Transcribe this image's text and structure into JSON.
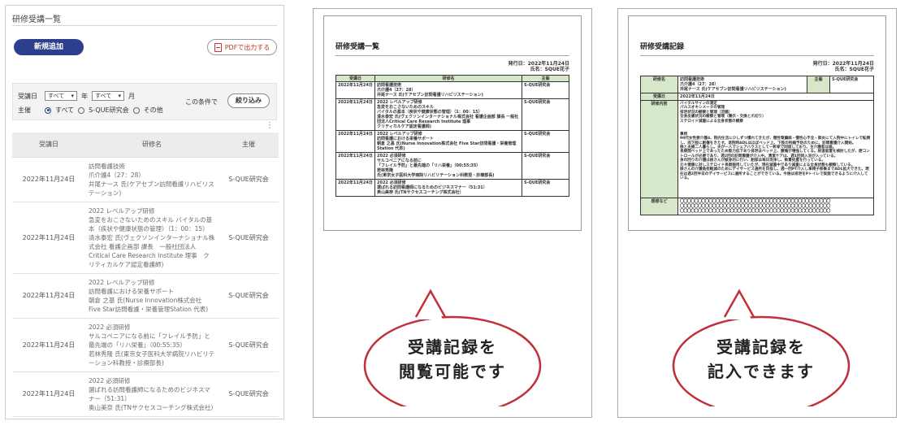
{
  "app": {
    "title": "研修受講一覧",
    "new_button": "新規追加",
    "pdf_button": "PDFで出力する",
    "filter": {
      "received_label": "受講日",
      "year_value": "すべて",
      "year_suffix": "年",
      "month_value": "すべて",
      "month_suffix": "月",
      "host_label": "主催",
      "radio_all": "すべて",
      "radio_sque": "S-QUE研究会",
      "radio_other": "その他",
      "condition_text": "この条件で",
      "narrow_button": "絞り込み"
    },
    "kebab": "⋮",
    "table": {
      "headers": [
        "受講日",
        "研修名",
        "主催"
      ],
      "rows": [
        {
          "date": "2022年11月24日",
          "name": "訪問看護技術\n爪介護4（27：28）\n井尾ナース 氏(ケアセブン訪問看護リハビリステーション)",
          "host": "S-QUE研究会"
        },
        {
          "date": "2022年11月24日",
          "name": "2022 レベルアップ研修\n急変をおこさないためのスキル バイタルの基本（疾状や健康状態の管理）（1：00：15）\n清水泰宏 氏(ヴェクソンインターナショナル株式会社 看護企画部 課長　一般社団法人Critical Care Research Institute 理事　クリティカルケア認定看護師)",
          "host": "S-QUE研究会"
        },
        {
          "date": "2022年11月24日",
          "name": "2022 レベルアップ研修\n訪問看護における栄養サポート\n朝倉 之基 氏(Nurse Innovation株式会社 Five Star訪問看護・栄養管理Station 代表)",
          "host": "S-QUE研究会"
        },
        {
          "date": "2022年11月24日",
          "name": "2022 必須研修\nサルコペニアになる前に「フレイル予防」と最先端の「リハ栄養」（00:55:35）\n若林秀隆 氏(東京女子医科大学病院リハビリテーション科教授・診療部長)",
          "host": "S-QUE研究会"
        },
        {
          "date": "2022年11月24日",
          "name": "2022 必須研修\n選ばれる訪問看護師になるためのビジネスマナー（51:31）\n奥山美奈 氏(TNサクセスコーチング株式会社）",
          "host": "S-QUE研究会"
        }
      ]
    }
  },
  "doc_list": {
    "title": "研修受講一覧",
    "issue_date": "発行日：2022年11月24日",
    "name": "氏名：SQUE花子",
    "headers": [
      "受講日",
      "研修名",
      "主催"
    ],
    "rows": [
      {
        "date": "2022年11月24日",
        "name": "訪問看護技術\n爪介護4（27：28）\n井尾ナース 氏(ケアセブン訪問看護リハビリステーション)",
        "host": "S-QUE研究会"
      },
      {
        "date": "2022年11月24日",
        "name": "2022 レベルアップ研修\n急変をおこさないためのスキル\nバイタルの基本（疾状や健康状態の管理）（1：00：15）\n清水泰宏 氏(ヴェクソンインターナショナル株式会社 看護企画部 課長 一般社団法人Critical Care Research Institute 理事\nクリティカルケア認定看護師)",
        "host": "S-QUE研究会"
      },
      {
        "date": "2022年11月24日",
        "name": "2022 レベルアップ研修\n訪問看護における栄養サポート\n朝倉 之基 氏(Nurse Innovation株式会社 Five Star訪問看護・栄養管理Station 代表)",
        "host": "S-QUE研究会"
      },
      {
        "date": "2022年11月24日",
        "name": "2022 必須研修\nサルコペニアになる前に\n「フレイル予防」と最先端の「リハ栄養」（00:55:35）\n若林秀隆\n氏(東京女子医科大学病院リハビリテーション科教授・診療部長)",
        "host": "S-QUE研究会"
      },
      {
        "date": "2022年11月24日",
        "name": "2022 必須研修\n選ばれる訪問看護師になるためのビジネスマナー（51:31）\n奥山美奈 氏(TNサクセスコーチング株式会社）",
        "host": "S-QUE研究会"
      }
    ]
  },
  "doc_record": {
    "title": "研修受講記録",
    "issue_date": "発行日：2022年11月24日",
    "name": "氏名：SQUE花子",
    "labels": {
      "training_name": "研修名",
      "host": "主催",
      "date": "受講日",
      "content": "研修内容",
      "thoughts": "感想など"
    },
    "training_name": "訪問看護技術\n爪介護4（27：28）\n井尾ナース 氏(ケアセブン訪問看護リハビリステーション)",
    "host": "S-QUE研究会",
    "date": "2022年11月24日",
    "content": "バイタルサインの測定\nパルスオキシメータの管理\n排泄状況の観察と管理（浣腸）\n全身皮膚状況の観察と管理（寝衣・交換と爪切り）\nステロイド減量による全身状態の観察\n\n\n事例\n90代女性要介護4、院内生活に少しずつ慣れてきたが、慢性腎臓病・慢性心不全・肺炎にて入院中にトイレで転倒し、両下肢に創傷をきたす。退院時ADLはほぼベッド上、下肢の拘縮予防のために、訪問看護介入開始。\n娘と夫婦二人暮らし。夫が一人でシェアハウスとして一軒家で同居しており、主介護者は娘。\n長期間ベッド上であったため筋力低下あり排泄はベッド上、腰痛が増強してくる。尿道留置を検討したが、便コントロールが必要であり、週2回の訪問看護が介入中。清潔ケアは、週1回同入浴が入っている。\n身の回りの介護は娘さんが献身的に行い、創部は毎日洗浄し、軟膏処置を行っている。\n元々健康に対しステロイド長期服用していたが、現在減量中であり減量による全身状態も観察している。\n娘さんの介護負担軽減のためにデイサービス通所を目指し、週一回PT介入し車椅子移乗までADL拡大できた。現在は週2回半日のデイサービスに通所することができている。今後は排泄をPトイレで実施できるように介入している。",
    "thoughts": "〇〇〇〇〇〇〇〇〇〇〇〇〇〇〇〇〇〇〇〇〇〇〇〇〇〇〇〇〇〇〇〇〇〇〇〇〇〇〇〇〇〇\n〇〇〇〇〇〇〇〇〇〇〇〇〇〇〇〇〇〇〇〇〇〇〇〇〇〇〇〇〇〇〇〇〇〇〇〇〇〇〇〇〇〇\n〇〇〇〇〇〇〇〇〇〇〇〇〇〇〇〇〇〇〇〇〇〇〇〇〇〇〇〇〇〇〇〇〇〇〇〇〇〇〇〇〇〇"
  },
  "bubbles": {
    "left": [
      "受講記録を",
      "閲覧可能です"
    ],
    "right": [
      "受講記録を",
      "記入できます"
    ]
  },
  "colors": {
    "navy": "#2b3f8c",
    "green_header": "#d7e7c9",
    "bubble_border": "#c0303a"
  },
  "icons": [
    "pdf-icon",
    "chevron-down-icon",
    "kebab-icon"
  ]
}
